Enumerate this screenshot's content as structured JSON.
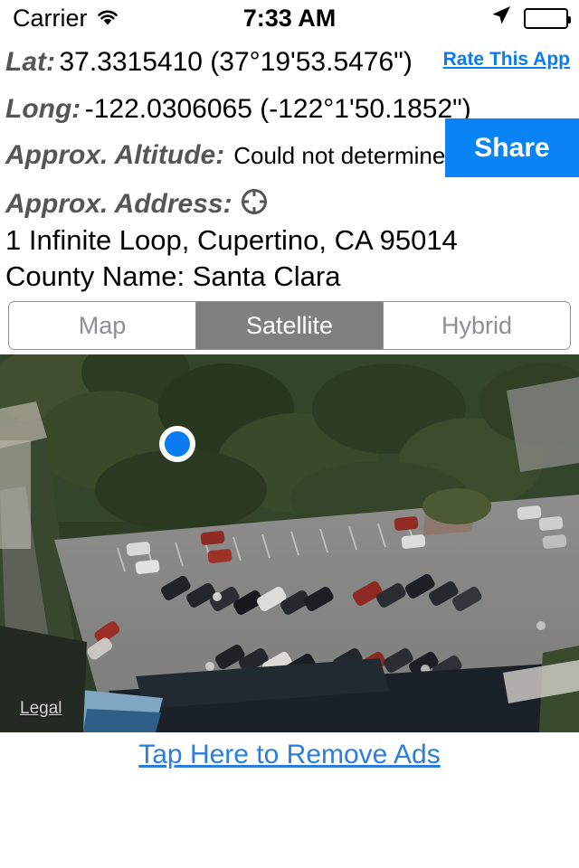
{
  "status_bar": {
    "carrier": "Carrier",
    "wifi_icon": "wifi-icon",
    "time": "7:33 AM",
    "location_arrow_icon": "location-arrow-icon",
    "battery_icon": "battery-full-icon"
  },
  "info": {
    "lat_label": "Lat:",
    "lat_value": "37.3315410 (37°19'53.5476\")",
    "long_label": "Long:",
    "long_value": "-122.0306065 (-122°1'50.1852\")",
    "altitude_label": "Approx. Altitude:",
    "altitude_value": "Could not determine",
    "address_label": "Approx. Address:",
    "address_icon": "crosshair-icon",
    "address_value": "1 Infinite Loop, Cupertino, CA 95014",
    "county_value": "County Name: Santa Clara"
  },
  "actions": {
    "rate_link": "Rate This App",
    "share_button": "Share",
    "ad_link": "Tap Here to Remove Ads"
  },
  "map_type_control": {
    "segments": [
      {
        "label": "Map",
        "selected": false
      },
      {
        "label": "Satellite",
        "selected": true
      },
      {
        "label": "Hybrid",
        "selected": false
      }
    ]
  },
  "map": {
    "legal_link": "Legal",
    "marker": "current-location-dot"
  },
  "colors": {
    "accent_blue": "#0a84f5",
    "link_blue": "#0b7bf0",
    "ad_blue": "#2a7de1",
    "segment_selected_bg": "#808080",
    "segment_border": "#8e8e93",
    "label_gray": "#555555"
  }
}
